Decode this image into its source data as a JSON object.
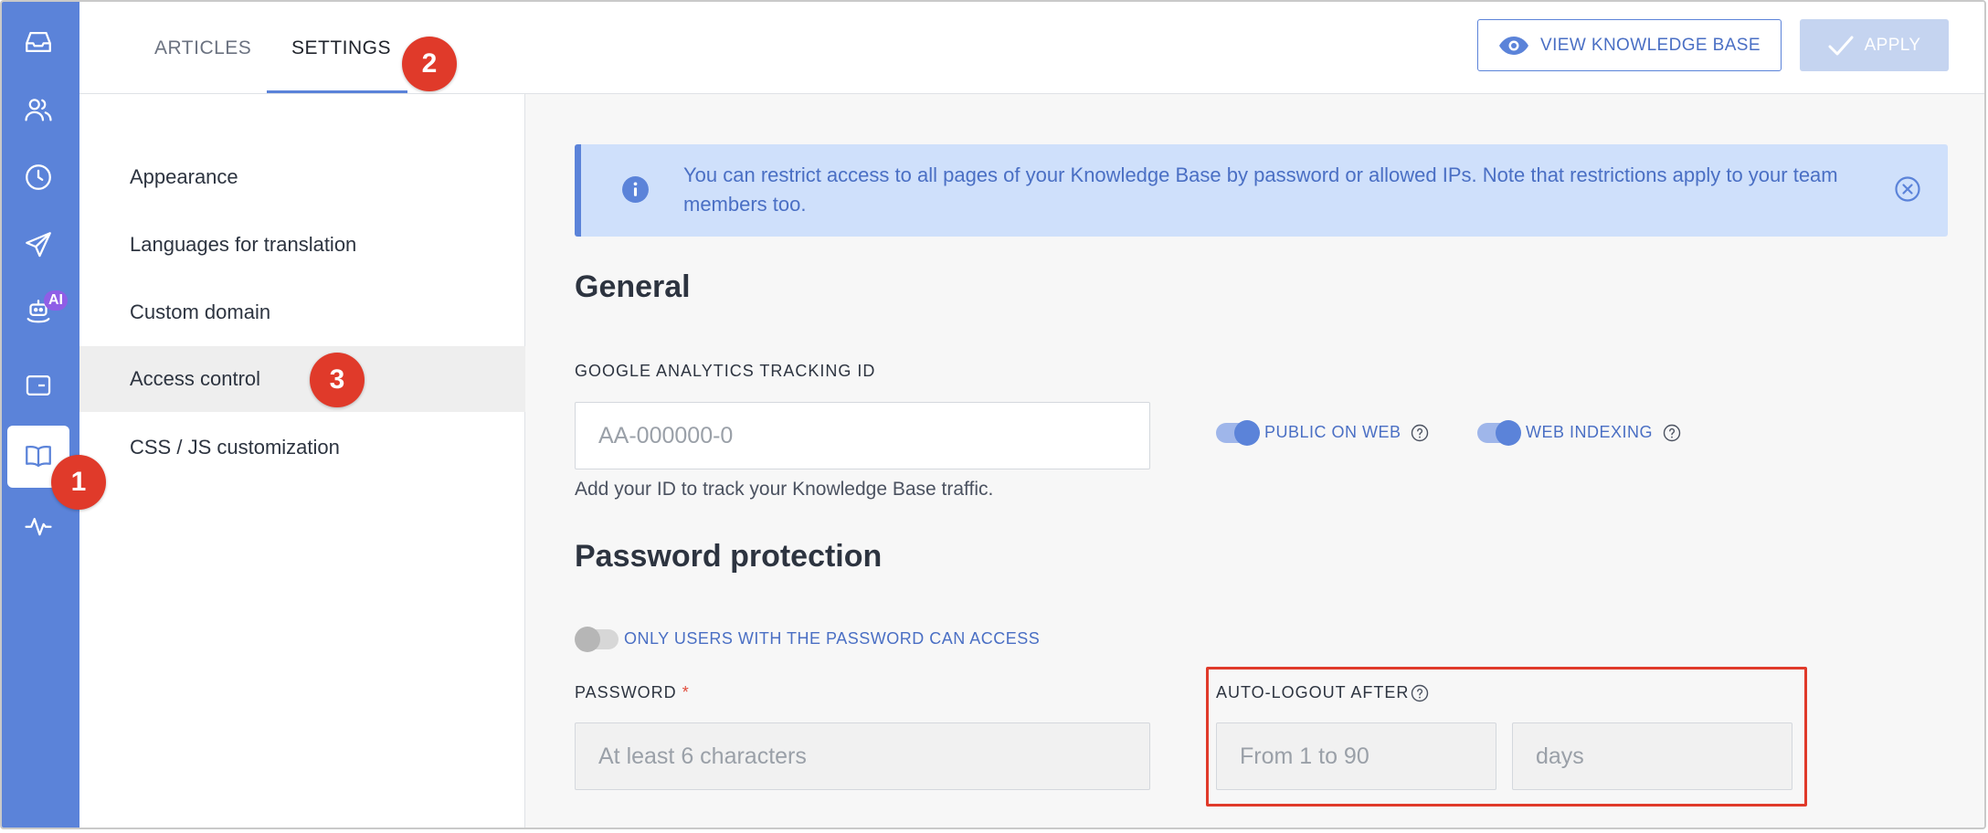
{
  "topbar": {
    "tabs": [
      {
        "label": "ARTICLES"
      },
      {
        "label": "SETTINGS"
      }
    ],
    "view_kb_label": "VIEW KNOWLEDGE BASE",
    "apply_label": "APPLY"
  },
  "rail": {
    "items": [
      {
        "icon": "inbox-icon"
      },
      {
        "icon": "contacts-icon"
      },
      {
        "icon": "history-icon"
      },
      {
        "icon": "send-icon"
      },
      {
        "icon": "ai-bot-icon",
        "badge": "AI"
      },
      {
        "icon": "widget-icon"
      },
      {
        "icon": "knowledge-base-icon",
        "active": true
      },
      {
        "icon": "analytics-icon"
      }
    ]
  },
  "sidebar": {
    "items": [
      {
        "label": "Appearance"
      },
      {
        "label": "Languages for translation"
      },
      {
        "label": "Custom domain"
      },
      {
        "label": "Access control",
        "active": true
      },
      {
        "label": "CSS / JS customization"
      }
    ]
  },
  "banner": {
    "text": "You can restrict access to all pages of your Knowledge Base by password or allowed IPs. Note that restrictions apply to your team members too."
  },
  "general": {
    "heading": "General",
    "ga_label": "GOOGLE ANALYTICS TRACKING ID",
    "ga_placeholder": "AA-000000-0",
    "ga_hint": "Add your ID to track your Knowledge Base traffic.",
    "public_on_web_label": "PUBLIC ON WEB",
    "public_on_web": true,
    "web_indexing_label": "WEB INDEXING",
    "web_indexing": true
  },
  "password_protection": {
    "heading": "Password protection",
    "toggle_label": "ONLY USERS WITH THE PASSWORD CAN ACCESS",
    "toggle_on": false,
    "password_label": "PASSWORD",
    "required_mark": "*",
    "password_placeholder": "At least 6 characters",
    "auto_logout_label": "AUTO-LOGOUT AFTER",
    "auto_logout_placeholder": "From 1 to 90",
    "unit_placeholder": "days"
  },
  "markers": [
    "1",
    "2",
    "3"
  ],
  "colors": {
    "rail": "#5b83d9",
    "accent": "#4a6fc4",
    "banner_bg": "#cfe0fb",
    "marker": "#e03a2a"
  }
}
